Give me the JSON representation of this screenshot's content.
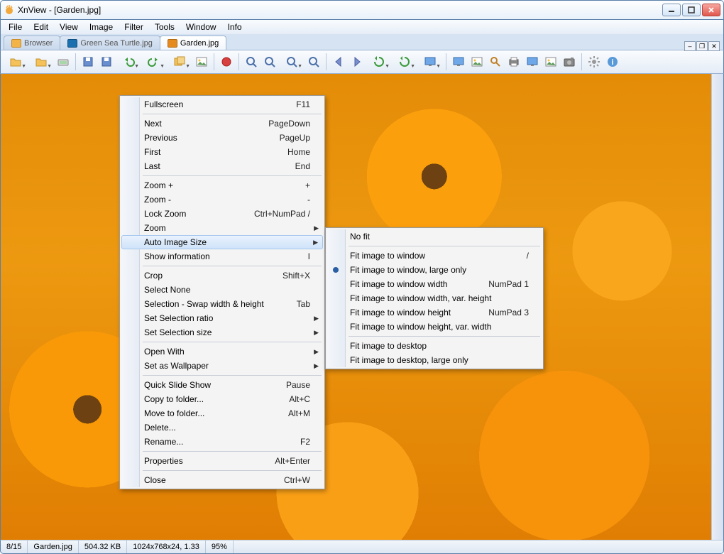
{
  "titlebar": {
    "app": "XnView",
    "doc": "[Garden.jpg]"
  },
  "menubar": [
    "File",
    "Edit",
    "View",
    "Image",
    "Filter",
    "Tools",
    "Window",
    "Info"
  ],
  "tabs": [
    {
      "label": "Browser",
      "icon_color": "#f2b348",
      "active": false
    },
    {
      "label": "Green Sea Turtle.jpg",
      "icon_color": "#1a6fae",
      "active": false
    },
    {
      "label": "Garden.jpg",
      "icon_color": "#e58a1f",
      "active": true
    }
  ],
  "context_menu": {
    "groups": [
      [
        {
          "label": "Fullscreen",
          "shortcut": "F11"
        }
      ],
      [
        {
          "label": "Next",
          "shortcut": "PageDown"
        },
        {
          "label": "Previous",
          "shortcut": "PageUp"
        },
        {
          "label": "First",
          "shortcut": "Home"
        },
        {
          "label": "Last",
          "shortcut": "End"
        }
      ],
      [
        {
          "label": "Zoom +",
          "shortcut": "+"
        },
        {
          "label": "Zoom -",
          "shortcut": "-"
        },
        {
          "label": "Lock Zoom",
          "shortcut": "Ctrl+NumPad /"
        },
        {
          "label": "Zoom",
          "submenu": true
        },
        {
          "label": "Auto Image Size",
          "submenu": true,
          "highlighted": true
        },
        {
          "label": "Show information",
          "shortcut": "I"
        }
      ],
      [
        {
          "label": "Crop",
          "shortcut": "Shift+X"
        },
        {
          "label": "Select None"
        },
        {
          "label": "Selection - Swap width & height",
          "shortcut": "Tab"
        },
        {
          "label": "Set Selection ratio",
          "submenu": true
        },
        {
          "label": "Set Selection size",
          "submenu": true
        }
      ],
      [
        {
          "label": "Open With",
          "submenu": true
        },
        {
          "label": "Set as Wallpaper",
          "submenu": true
        }
      ],
      [
        {
          "label": "Quick Slide Show",
          "shortcut": "Pause"
        },
        {
          "label": "Copy to folder...",
          "shortcut": "Alt+C"
        },
        {
          "label": "Move to folder...",
          "shortcut": "Alt+M"
        },
        {
          "label": "Delete..."
        },
        {
          "label": "Rename...",
          "shortcut": "F2"
        }
      ],
      [
        {
          "label": "Properties",
          "shortcut": "Alt+Enter"
        }
      ],
      [
        {
          "label": "Close",
          "shortcut": "Ctrl+W"
        }
      ]
    ]
  },
  "submenu": {
    "groups": [
      [
        {
          "label": "No fit"
        }
      ],
      [
        {
          "label": "Fit image to window",
          "shortcut": "/"
        },
        {
          "label": "Fit image to window, large only",
          "radio": true
        },
        {
          "label": "Fit image to window width",
          "shortcut": "NumPad 1"
        },
        {
          "label": "Fit image to window width, var. height"
        },
        {
          "label": "Fit image to window height",
          "shortcut": "NumPad 3"
        },
        {
          "label": "Fit image to window height, var. width"
        }
      ],
      [
        {
          "label": "Fit image to desktop"
        },
        {
          "label": "Fit image to desktop, large only"
        }
      ]
    ]
  },
  "statusbar": {
    "index": "8/15",
    "filename": "Garden.jpg",
    "filesize": "504.32 KB",
    "dimensions": "1024x768x24, 1.33",
    "zoom": "95%"
  },
  "toolbar_icons": [
    "quickview-dd",
    "browse-dd",
    "acquire",
    "sep",
    "save",
    "saveas",
    "undo-dd",
    "redo-dd",
    "convert-dd",
    "batch",
    "sep",
    "tag-red",
    "sep",
    "zoom-in",
    "zoom-100",
    "zoom-out-dd",
    "zoom-out",
    "sep",
    "prev",
    "next",
    "rotate-ccw-dd",
    "rotate-cw-dd",
    "fit-dd",
    "sep",
    "fullscreen",
    "slideshow",
    "search",
    "print",
    "compare",
    "capture",
    "snapshot",
    "sep",
    "settings",
    "info"
  ]
}
